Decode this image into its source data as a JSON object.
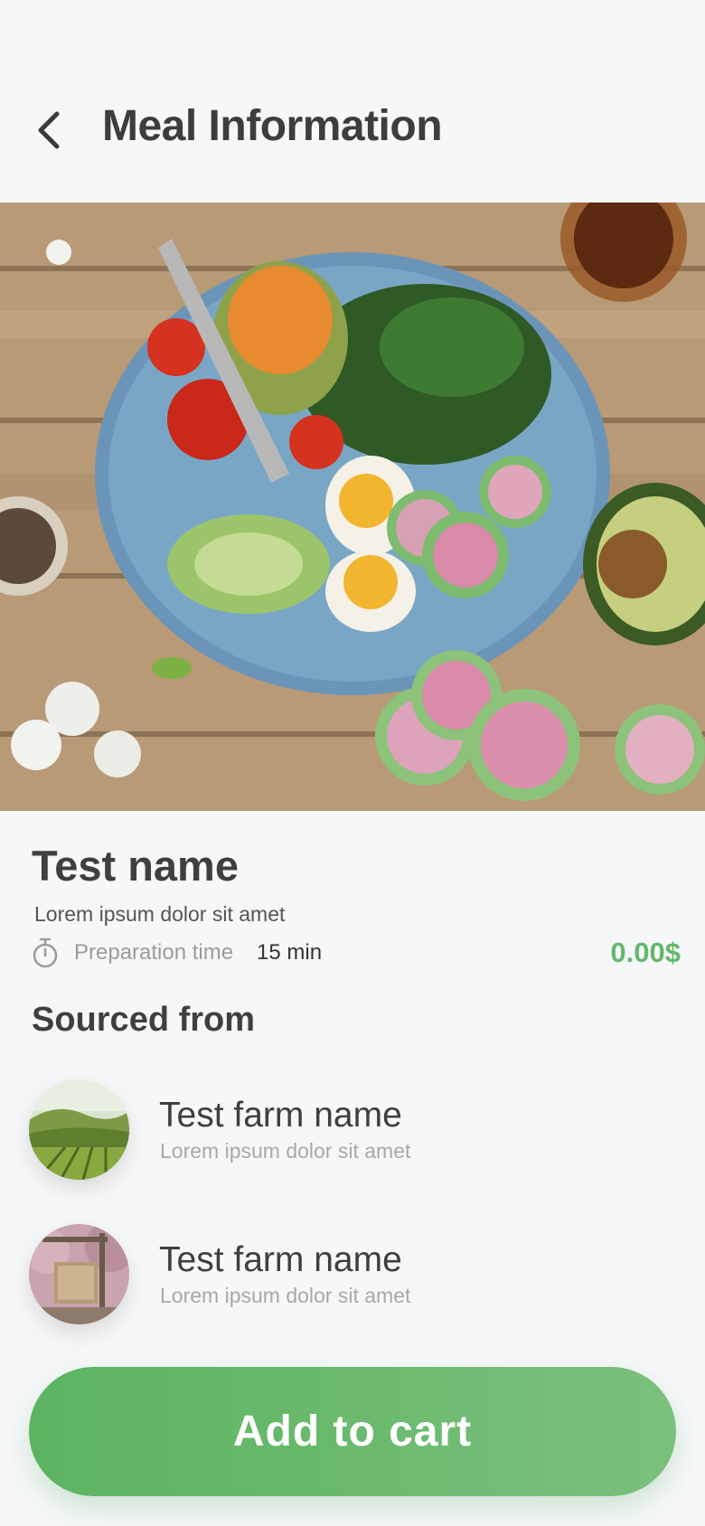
{
  "header": {
    "title": "Meal Information",
    "back_icon": "chevron-left-icon"
  },
  "hero": {
    "image": "salad-bowl-photo"
  },
  "meal": {
    "name": "Test name",
    "description": "Lorem ipsum dolor sit amet",
    "prep_label": "Preparation time",
    "prep_value": "15 min",
    "price": "0.00$",
    "timer_icon": "stopwatch-icon"
  },
  "sourced": {
    "title": "Sourced from",
    "farms": [
      {
        "name": "Test farm name",
        "description": "Lorem ipsum dolor sit amet",
        "avatar": "green-hills-field-photo"
      },
      {
        "name": "Test farm name",
        "description": "Lorem ipsum dolor sit amet",
        "avatar": "farm-sign-photo"
      }
    ]
  },
  "cart": {
    "label": "Add to cart"
  },
  "colors": {
    "accent": "#63b86c",
    "background": "#f6f7f9",
    "text": "#3f3f3f"
  }
}
